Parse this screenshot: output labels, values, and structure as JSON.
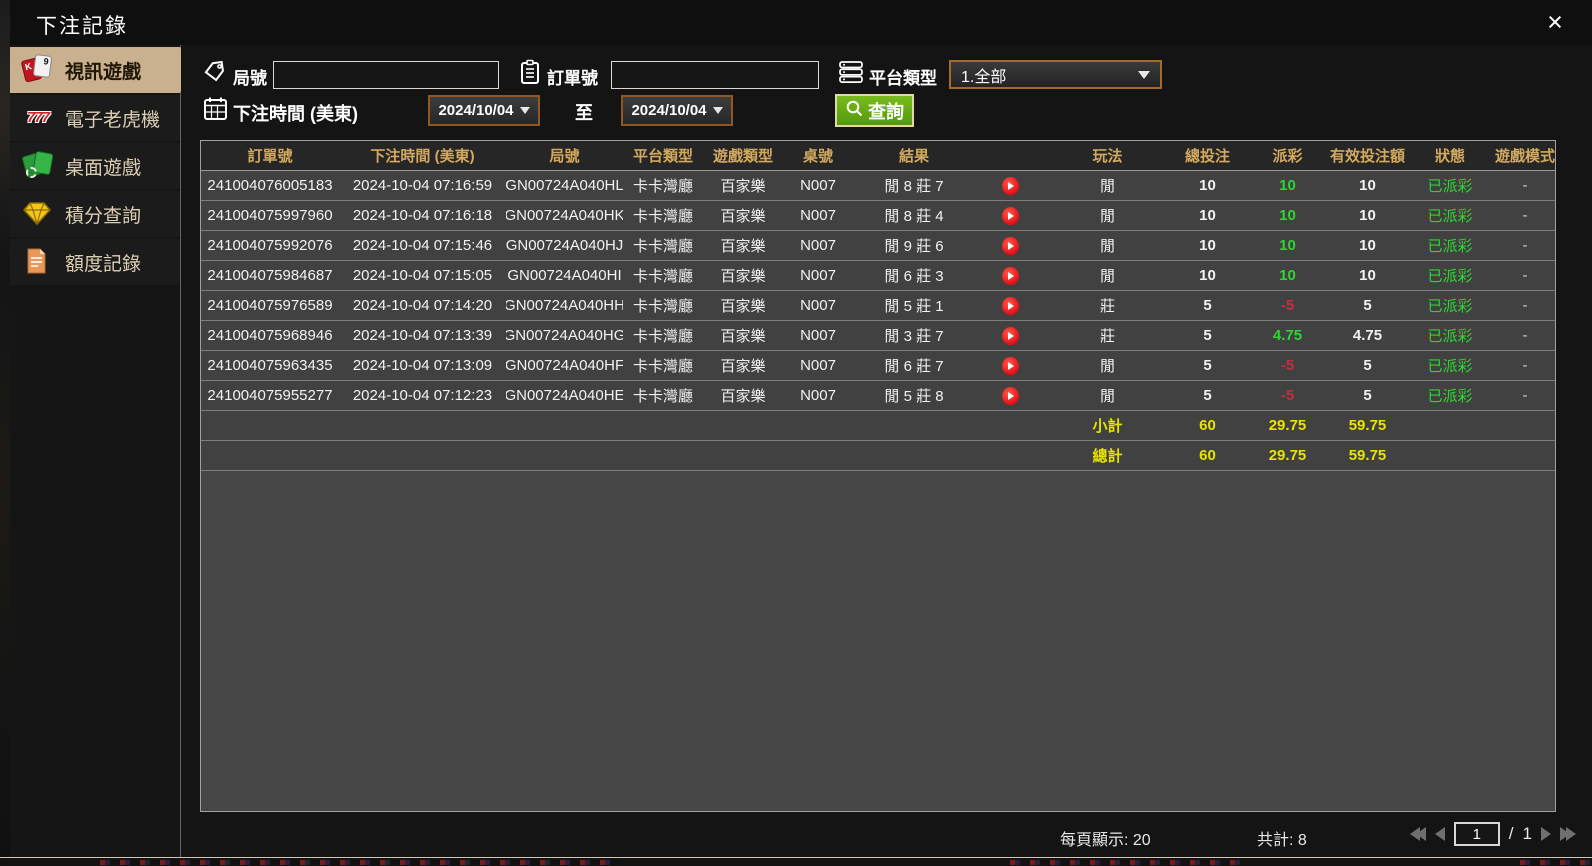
{
  "window": {
    "title": "下注記錄",
    "close_glyph": "×"
  },
  "sidebar": {
    "items": [
      {
        "label": "視訊遊戲",
        "icon": "cards-icon",
        "active": true
      },
      {
        "label": "電子老虎機",
        "icon": "slots-777-icon",
        "active": false
      },
      {
        "label": "桌面遊戲",
        "icon": "table-games-icon",
        "active": false
      },
      {
        "label": "積分查詢",
        "icon": "points-gem-icon",
        "active": false
      },
      {
        "label": "額度記錄",
        "icon": "credit-record-icon",
        "active": false
      }
    ]
  },
  "filters": {
    "round_label": "局號",
    "round_value": "",
    "order_label": "訂單號",
    "order_value": "",
    "platform_label": "平台類型",
    "platform_value": "1.全部",
    "time_label": "下注時間 (美東)",
    "date_from": "2024/10/04",
    "to_label": "至",
    "date_to": "2024/10/04",
    "search_label": "查詢"
  },
  "table": {
    "headers": [
      "訂單號",
      "下注時間 (美東)",
      "局號",
      "平台類型",
      "遊戲類型",
      "桌號",
      "結果",
      "玩法",
      "總投注",
      "派彩",
      "有效投注額",
      "狀態",
      "遊戲模式"
    ],
    "rows": [
      {
        "order": "241004076005183",
        "time": "2024-10-04 07:16:59",
        "round": "GN00724A040HL",
        "platform": "卡卡灣廳",
        "game": "百家樂",
        "table_no": "N007",
        "result": "閒 8 莊 7",
        "play": "閒",
        "bet": "10",
        "payout": "10",
        "payout_color": "green",
        "valid": "10",
        "status": "已派彩",
        "mode": "-"
      },
      {
        "order": "241004075997960",
        "time": "2024-10-04 07:16:18",
        "round": "GN00724A040HK",
        "platform": "卡卡灣廳",
        "game": "百家樂",
        "table_no": "N007",
        "result": "閒 8 莊 4",
        "play": "閒",
        "bet": "10",
        "payout": "10",
        "payout_color": "green",
        "valid": "10",
        "status": "已派彩",
        "mode": "-"
      },
      {
        "order": "241004075992076",
        "time": "2024-10-04 07:15:46",
        "round": "GN00724A040HJ",
        "platform": "卡卡灣廳",
        "game": "百家樂",
        "table_no": "N007",
        "result": "閒 9 莊 6",
        "play": "閒",
        "bet": "10",
        "payout": "10",
        "payout_color": "green",
        "valid": "10",
        "status": "已派彩",
        "mode": "-"
      },
      {
        "order": "241004075984687",
        "time": "2024-10-04 07:15:05",
        "round": "GN00724A040HI",
        "platform": "卡卡灣廳",
        "game": "百家樂",
        "table_no": "N007",
        "result": "閒 6 莊 3",
        "play": "閒",
        "bet": "10",
        "payout": "10",
        "payout_color": "green",
        "valid": "10",
        "status": "已派彩",
        "mode": "-"
      },
      {
        "order": "241004075976589",
        "time": "2024-10-04 07:14:20",
        "round": "GN00724A040HH",
        "platform": "卡卡灣廳",
        "game": "百家樂",
        "table_no": "N007",
        "result": "閒 5 莊 1",
        "play": "莊",
        "bet": "5",
        "payout": "-5",
        "payout_color": "red",
        "valid": "5",
        "status": "已派彩",
        "mode": "-"
      },
      {
        "order": "241004075968946",
        "time": "2024-10-04 07:13:39",
        "round": "GN00724A040HG",
        "platform": "卡卡灣廳",
        "game": "百家樂",
        "table_no": "N007",
        "result": "閒 3 莊 7",
        "play": "莊",
        "bet": "5",
        "payout": "4.75",
        "payout_color": "green",
        "valid": "4.75",
        "status": "已派彩",
        "mode": "-"
      },
      {
        "order": "241004075963435",
        "time": "2024-10-04 07:13:09",
        "round": "GN00724A040HF",
        "platform": "卡卡灣廳",
        "game": "百家樂",
        "table_no": "N007",
        "result": "閒 6 莊 7",
        "play": "閒",
        "bet": "5",
        "payout": "-5",
        "payout_color": "red",
        "valid": "5",
        "status": "已派彩",
        "mode": "-"
      },
      {
        "order": "241004075955277",
        "time": "2024-10-04 07:12:23",
        "round": "GN00724A040HE",
        "platform": "卡卡灣廳",
        "game": "百家樂",
        "table_no": "N007",
        "result": "閒 5 莊 8",
        "play": "閒",
        "bet": "5",
        "payout": "-5",
        "payout_color": "red",
        "valid": "5",
        "status": "已派彩",
        "mode": "-"
      }
    ],
    "subtotal": {
      "label": "小計",
      "bet": "60",
      "payout": "29.75",
      "valid": "59.75"
    },
    "total": {
      "label": "總計",
      "bet": "60",
      "payout": "29.75",
      "valid": "59.75"
    }
  },
  "pagination": {
    "per_page_text": "每頁顯示: 20",
    "total_text": "共計: 8",
    "page": "1",
    "separator": "/",
    "total_pages": "1"
  },
  "colors": {
    "accent_tan": "#c9b190",
    "header_gold": "#d2a95f",
    "positive_green": "#2fd532",
    "negative_red": "#c2303c",
    "sum_yellow": "#e8e400",
    "search_green": "#5fa812"
  }
}
